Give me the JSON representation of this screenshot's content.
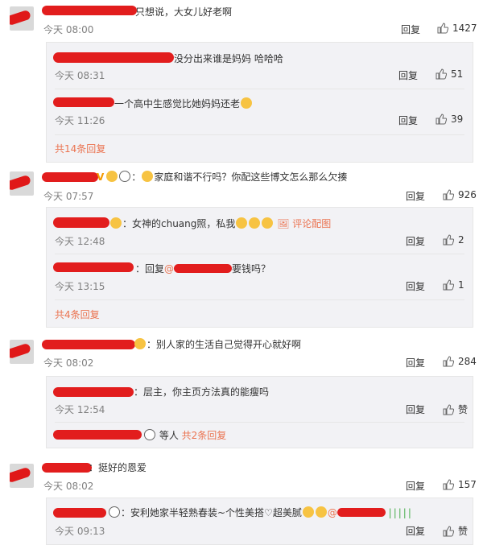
{
  "c1": {
    "text": "只想说，大女儿好老啊",
    "time": "今天 08:00",
    "reply": "回复",
    "likes": "1427",
    "subs": [
      {
        "text": "没分出来谁是妈妈 哈哈哈",
        "time": "今天 08:31",
        "reply": "回复",
        "likes": "51"
      },
      {
        "text": "一个高中生感觉比她妈妈还老",
        "time": "今天 11:26",
        "reply": "回复",
        "likes": "39"
      }
    ],
    "more": "共14条回复"
  },
  "c2": {
    "text": "家庭和谐不行吗？你配这些博文怎么那么欠揍",
    "time": "今天 07:57",
    "reply": "回复",
    "likes": "926",
    "subs": [
      {
        "text": "：女神的chuang照，私我",
        "extra": "评论配图",
        "time": "今天 12:48",
        "reply": "回复",
        "likes": "2"
      },
      {
        "text": "回复",
        "mention": "@",
        "text2": "要钱吗？",
        "time": "今天 13:15",
        "reply": "回复",
        "likes": "1"
      }
    ],
    "more": "共4条回复"
  },
  "c3": {
    "text": "：别人家的生活自己觉得开心就好啊",
    "time": "今天 08:02",
    "reply": "回复",
    "likes": "284",
    "subs": [
      {
        "text": "层主，你主页方法真的能瘦吗",
        "time": "今天 12:54",
        "reply": "回复",
        "likes": "赞"
      }
    ],
    "summary_people": "等人",
    "more": "共2条回复"
  },
  "c4": {
    "text": "：挺好的恩爱",
    "time": "今天 08:02",
    "reply": "回复",
    "likes": "157",
    "subs": [
      {
        "text": "：安利她家半轻熟春装~个性美搭♡超美腻",
        "mention": "@",
        "time": "今天 09:13",
        "reply": "回复",
        "likes": "赞"
      }
    ]
  },
  "colors": {
    "accent": "#eb7350",
    "redaction": "#e21d1d",
    "subbox": "#f2f2f5"
  }
}
